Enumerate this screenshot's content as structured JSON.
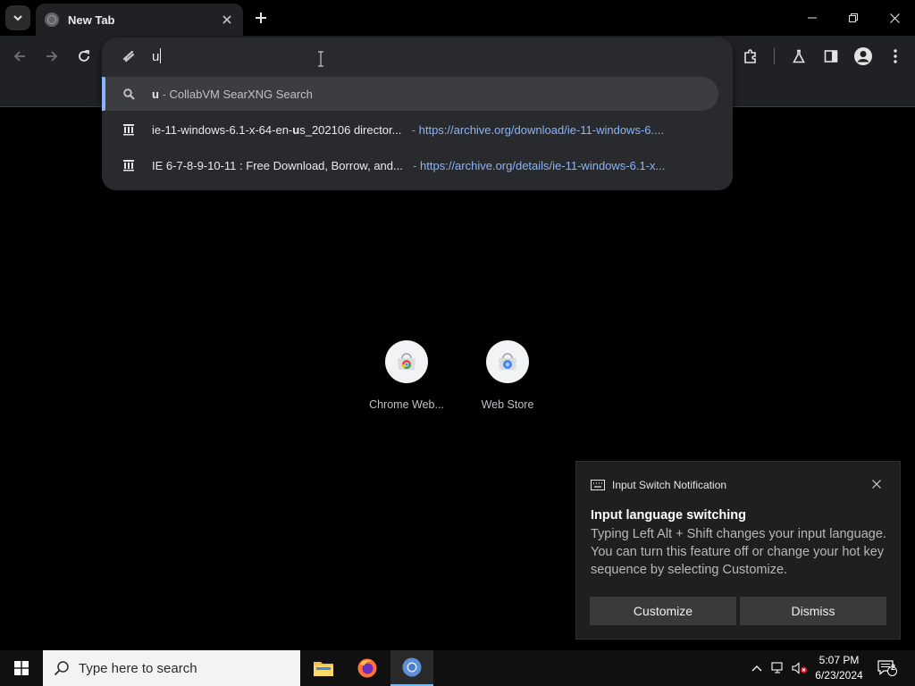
{
  "browser": {
    "tab": {
      "title": "New Tab"
    },
    "omnibox": {
      "typed_text": "u",
      "suggestions": [
        {
          "prefix": "u",
          "sep": " - ",
          "text": "CollabVM SearXNG Search",
          "icon": "search-icon"
        },
        {
          "pre": "ie-11-windows-6.1-x-64-en-",
          "match": "u",
          "post": "s_202106 director...",
          "sep": " - ",
          "url": "https://archive.org/download/ie-11-windows-6....",
          "icon": "archive-org-icon"
        },
        {
          "text": "IE 6-7-8-9-10-11 : Free Download, Borrow, and...",
          "sep": " - ",
          "url": "https://archive.org/details/ie-11-windows-6.1-x...",
          "icon": "archive-org-icon"
        }
      ]
    },
    "shortcuts": [
      {
        "label": "Chrome Web..."
      },
      {
        "label": "Web Store"
      }
    ],
    "colors": {
      "accent": "#8ab4f8",
      "frame": "#202124",
      "dropdown": "#282a2d"
    }
  },
  "notification": {
    "header": "Input Switch Notification",
    "title": "Input language switching",
    "body": "Typing Left Alt + Shift changes your input language. You can turn this feature off or change your hot key sequence by selecting Customize.",
    "buttons": {
      "customize": "Customize",
      "dismiss": "Dismiss"
    }
  },
  "taskbar": {
    "search_placeholder": "Type here to search",
    "time": "5:07 PM",
    "date": "6/23/2024",
    "notification_count": "2"
  }
}
